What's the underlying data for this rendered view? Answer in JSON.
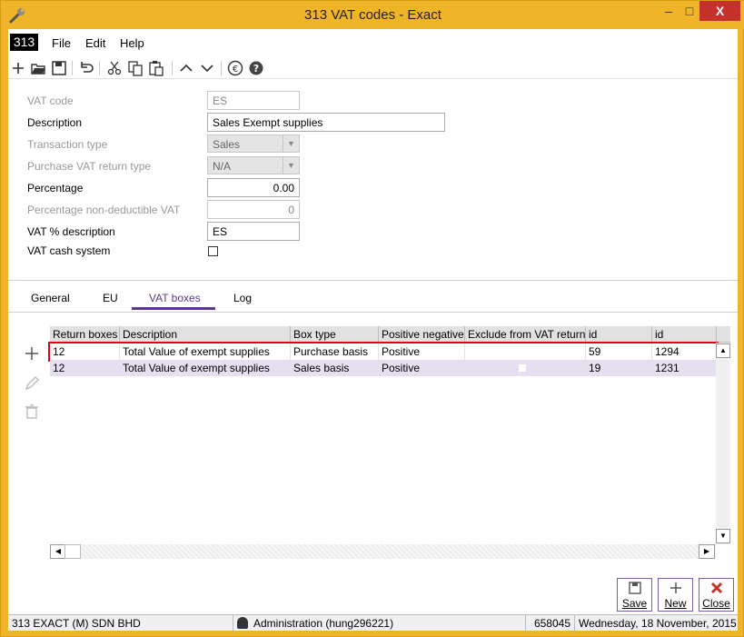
{
  "window": {
    "title": "313 VAT codes - Exact",
    "minimize": "–",
    "maximize": "□",
    "close": "X"
  },
  "menubar": {
    "company_badge": "313",
    "file": "File",
    "edit": "Edit",
    "help": "Help"
  },
  "toolbar": {
    "icons": [
      "add-icon",
      "open-folder-icon",
      "save-icon",
      "undo-icon",
      "cut-icon",
      "copy-icon",
      "paste-icon",
      "up-arrow-icon",
      "down-arrow-icon",
      "euro-icon",
      "help-icon"
    ]
  },
  "form": {
    "vat_code_label": "VAT code",
    "vat_code_value": "ES",
    "description_label": "Description",
    "description_value": "Sales Exempt supplies",
    "transaction_type_label": "Transaction type",
    "transaction_type_value": "Sales",
    "purchase_vat_label": "Purchase VAT return type",
    "purchase_vat_value": "N/A",
    "percentage_label": "Percentage",
    "percentage_value": "0.00",
    "pct_nondeductible_label": "Percentage non-deductible VAT",
    "pct_nondeductible_value": "0",
    "vat_pct_desc_label": "VAT % description",
    "vat_pct_desc_value": "ES",
    "cash_system_label": "VAT cash system",
    "cash_system_checked": false
  },
  "tabs": {
    "general": "General",
    "eu": "EU",
    "vat_boxes": "VAT boxes",
    "log": "Log",
    "active": "VAT boxes"
  },
  "grid": {
    "headers": [
      "Return boxes",
      "Description",
      "Box type",
      "Positive negative",
      "Exclude from VAT return",
      "id",
      "id"
    ],
    "rows": [
      {
        "return_boxes": "12",
        "description": "Total Value of exempt supplies",
        "box_type": "Purchase basis",
        "pos_neg": "Positive",
        "exclude": "",
        "id1": "59",
        "id2": "1294",
        "selected": true
      },
      {
        "return_boxes": "12",
        "description": "Total Value of exempt supplies",
        "box_type": "Sales basis",
        "pos_neg": "Positive",
        "exclude": "",
        "id1": "19",
        "id2": "1231",
        "selected": false
      }
    ]
  },
  "actions": {
    "save": "Save",
    "new": "New",
    "close": "Close"
  },
  "status": {
    "company": "313 EXACT (M) SDN BHD",
    "user": "Administration (hung296221)",
    "number": "658045",
    "date": "Wednesday, 18 November, 2015"
  },
  "colors": {
    "frame": "#f0b429",
    "accent": "#5b3a8e",
    "selection_border": "#e0001a",
    "alt_row": "#e6dff0",
    "close_button": "#c7312b"
  }
}
